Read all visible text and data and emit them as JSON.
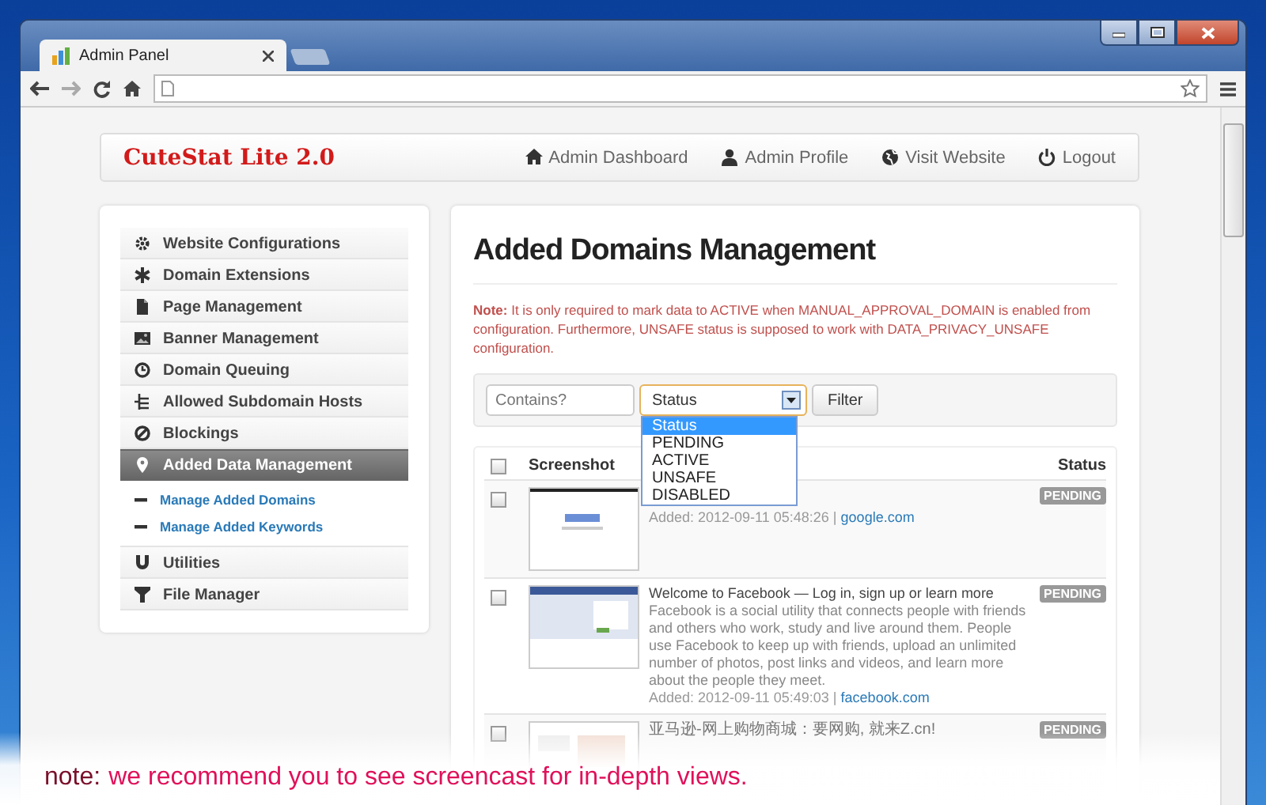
{
  "browser": {
    "tab_title": "Admin Panel"
  },
  "navbar": {
    "brand": "CuteStat Lite 2.0",
    "links": [
      {
        "label": "Admin Dashboard"
      },
      {
        "label": "Admin Profile"
      },
      {
        "label": "Visit Website"
      },
      {
        "label": "Logout"
      }
    ]
  },
  "sidebar": {
    "items": [
      {
        "label": "Website Configurations",
        "selected": false
      },
      {
        "label": "Domain Extensions",
        "selected": false
      },
      {
        "label": "Page Management",
        "selected": false
      },
      {
        "label": "Banner Management",
        "selected": false
      },
      {
        "label": "Domain Queuing",
        "selected": false
      },
      {
        "label": "Allowed Subdomain Hosts",
        "selected": false
      },
      {
        "label": "Blockings",
        "selected": false
      },
      {
        "label": "Added Data Management",
        "selected": true,
        "children": [
          {
            "label": "Manage Added Domains"
          },
          {
            "label": "Manage Added Keywords"
          }
        ]
      },
      {
        "label": "Utilities",
        "selected": false
      },
      {
        "label": "File Manager",
        "selected": false
      }
    ]
  },
  "main": {
    "title": "Added Domains Management",
    "note": {
      "label": "Note:",
      "text": "It is only required to mark data to ACTIVE when MANUAL_APPROVAL_DOMAIN is enabled from configuration. Furthermore, UNSAFE status is supposed to work with DATA_PRIVACY_UNSAFE configuration."
    },
    "filter": {
      "placeholder": "Contains?",
      "status_select": {
        "value": "Status",
        "open": true,
        "options": [
          {
            "label": "Status",
            "selected": true
          },
          {
            "label": "PENDING",
            "selected": false
          },
          {
            "label": "ACTIVE",
            "selected": false
          },
          {
            "label": "UNSAFE",
            "selected": false
          },
          {
            "label": "DISABLED",
            "selected": false
          }
        ]
      },
      "button": "Filter"
    },
    "table": {
      "header_checked": false,
      "columns": [
        {
          "label": "Screenshot"
        },
        {
          "label": "Status"
        }
      ],
      "rows": [
        {
          "checked": false,
          "added": "Added: 2012-09-11 05:48:26 |",
          "link": "google.com",
          "status": "PENDING"
        },
        {
          "checked": false,
          "title": "Welcome to Facebook — Log in, sign up or learn more",
          "description": "Facebook is a social utility that connects people with friends and others who work, study and live around them. People use Facebook to keep up with friends, upload an unlimited number of photos, post links and videos, and learn more about the people they meet.",
          "added": "Added: 2012-09-11 05:49:03 |",
          "link": "facebook.com",
          "status": "PENDING"
        },
        {
          "checked": false,
          "title": "亚马逊-网上购物商城：要网购, 就来Z.cn!",
          "status": "PENDING"
        }
      ]
    }
  },
  "footer_note": {
    "label": "note:",
    "text": "we recommend you to see screencast for in-depth views."
  }
}
